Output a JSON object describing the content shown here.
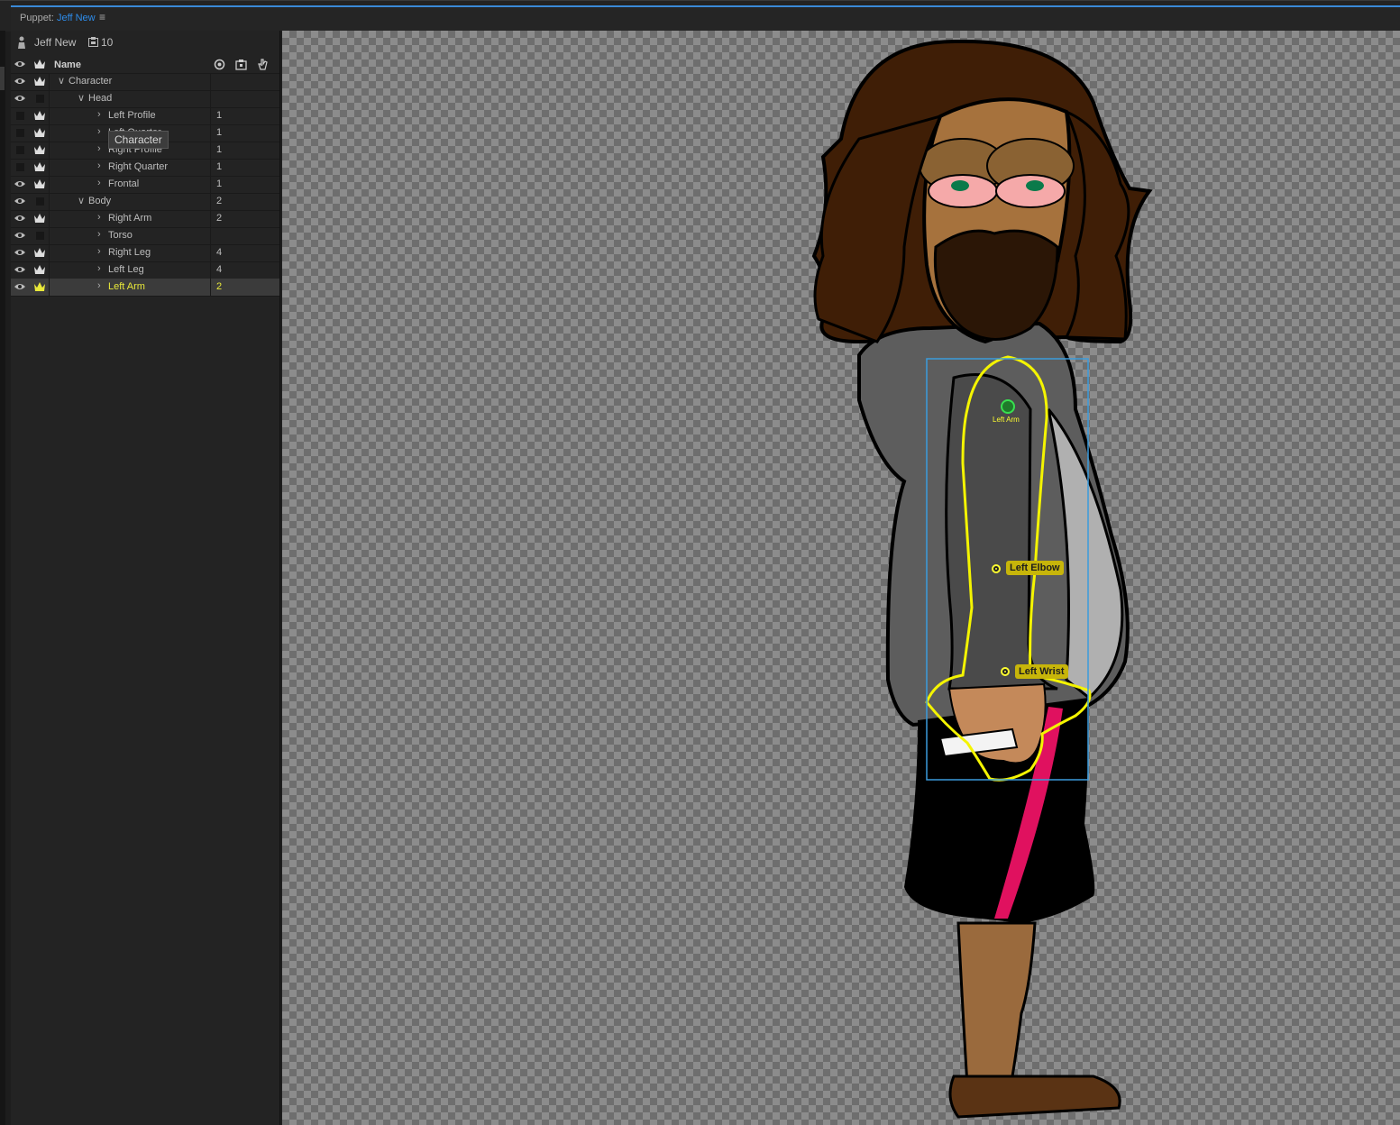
{
  "tab": {
    "prefix": "Puppet:",
    "name": "Jeff New",
    "menu_icon": "hamburger-icon"
  },
  "puppet": {
    "name": "Jeff New",
    "layer_count": "10"
  },
  "columns": {
    "name": "Name"
  },
  "tooltip": "Character",
  "rows": [
    {
      "label": "Character",
      "count": "",
      "depth": 0,
      "expanded": true,
      "eye": true,
      "crown": true
    },
    {
      "label": "Head",
      "count": "",
      "depth": 1,
      "expanded": true,
      "eye": true,
      "crown": false
    },
    {
      "label": "Left Profile",
      "count": "1",
      "depth": 2,
      "expanded": false,
      "eye": false,
      "crown": true
    },
    {
      "label": "Left Quarter",
      "count": "1",
      "depth": 2,
      "expanded": false,
      "eye": false,
      "crown": true
    },
    {
      "label": "Right Profile",
      "count": "1",
      "depth": 2,
      "expanded": false,
      "eye": false,
      "crown": true
    },
    {
      "label": "Right Quarter",
      "count": "1",
      "depth": 2,
      "expanded": false,
      "eye": false,
      "crown": true
    },
    {
      "label": "Frontal",
      "count": "1",
      "depth": 2,
      "expanded": false,
      "eye": true,
      "crown": true
    },
    {
      "label": "Body",
      "count": "2",
      "depth": 1,
      "expanded": true,
      "eye": true,
      "crown": false
    },
    {
      "label": "Right Arm",
      "count": "2",
      "depth": 2,
      "expanded": false,
      "eye": true,
      "crown": true
    },
    {
      "label": "Torso",
      "count": "",
      "depth": 2,
      "expanded": false,
      "eye": true,
      "crown": false
    },
    {
      "label": "Right Leg",
      "count": "4",
      "depth": 2,
      "expanded": false,
      "eye": true,
      "crown": true
    },
    {
      "label": "Left Leg",
      "count": "4",
      "depth": 2,
      "expanded": false,
      "eye": true,
      "crown": true
    },
    {
      "label": "Left Arm",
      "count": "2",
      "depth": 2,
      "expanded": false,
      "eye": true,
      "crown": true,
      "selected": true
    }
  ],
  "handles": {
    "origin": "Left Arm",
    "elbow": "Left Elbow",
    "wrist": "Left Wrist"
  },
  "colors": {
    "accent": "#2d8ceb",
    "selection": "#e8e83a",
    "handle_tag": "#c7b50a"
  }
}
